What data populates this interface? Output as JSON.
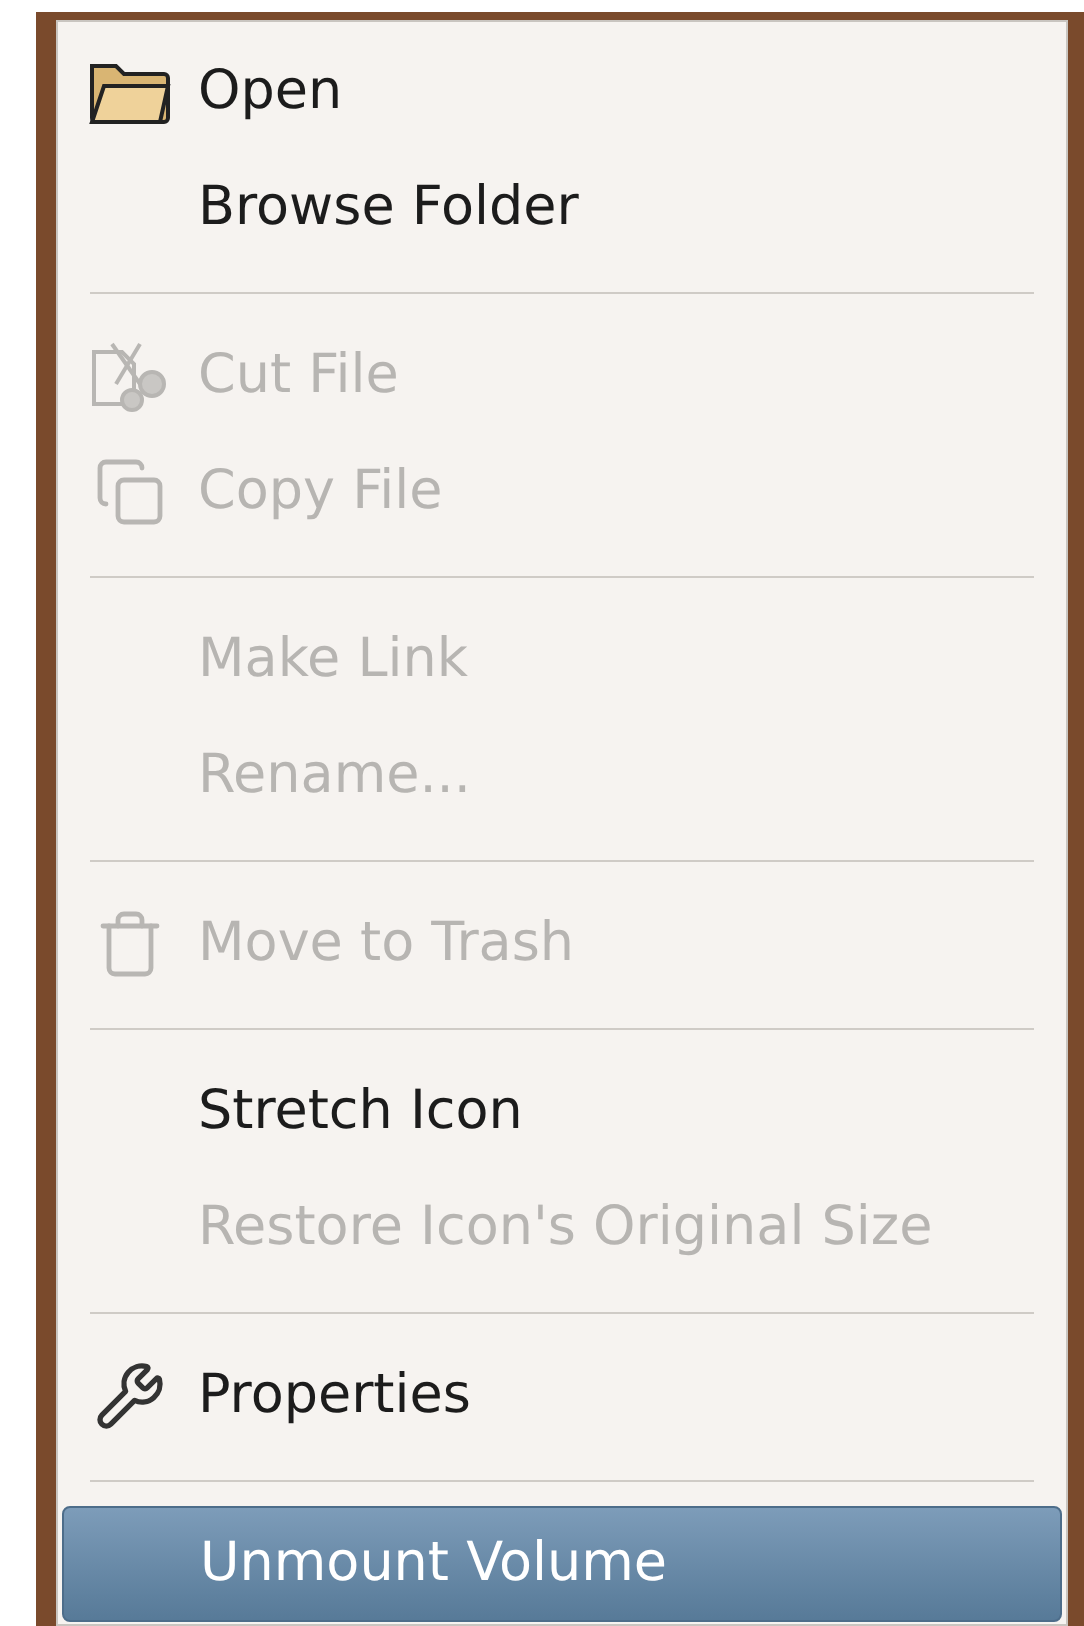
{
  "menu": {
    "entries": [
      {
        "kind": "item",
        "label": "Open",
        "disabled": false,
        "selected": false
      },
      {
        "kind": "item",
        "label": "Browse Folder",
        "disabled": false,
        "selected": false
      },
      {
        "kind": "separator"
      },
      {
        "kind": "item",
        "label": "Cut File",
        "disabled": true,
        "selected": false
      },
      {
        "kind": "item",
        "label": "Copy File",
        "disabled": true,
        "selected": false
      },
      {
        "kind": "separator"
      },
      {
        "kind": "item",
        "label": "Make Link",
        "disabled": true,
        "selected": false
      },
      {
        "kind": "item",
        "label": "Rename...",
        "disabled": true,
        "selected": false
      },
      {
        "kind": "separator"
      },
      {
        "kind": "item",
        "label": "Move to Trash",
        "disabled": true,
        "selected": false
      },
      {
        "kind": "separator"
      },
      {
        "kind": "item",
        "label": "Stretch Icon",
        "disabled": false,
        "selected": false
      },
      {
        "kind": "item",
        "label": "Restore Icon's Original Size",
        "disabled": true,
        "selected": false
      },
      {
        "kind": "separator"
      },
      {
        "kind": "item",
        "label": "Properties",
        "disabled": false,
        "selected": false
      },
      {
        "kind": "separator"
      },
      {
        "kind": "item",
        "label": "Unmount Volume",
        "disabled": false,
        "selected": true
      }
    ]
  }
}
